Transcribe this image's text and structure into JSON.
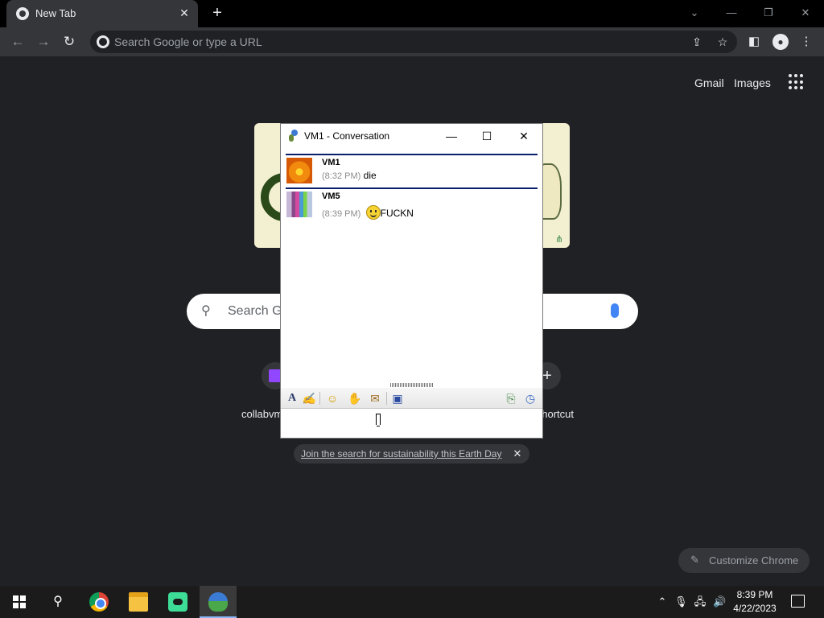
{
  "browser": {
    "tab_title": "New Tab",
    "tab_close": "✕",
    "new_tab": "+",
    "omnibox_placeholder": "Search Google or type a URL"
  },
  "ntp": {
    "gmail": "Gmail",
    "images": "Images",
    "search_placeholder": "Search Google or type a URL",
    "shortcut_1_label": "collabvm",
    "shortcut_add_label": "Add shortcut",
    "promo_text": "Join the search for sustainability this Earth Day",
    "customize_label": "Customize Chrome"
  },
  "messenger": {
    "title": "VM1 - Conversation",
    "messages": [
      {
        "sender": "VM1",
        "time": "(8:32 PM)",
        "text": "die",
        "avatar": "orange-flower",
        "emoticon": false
      },
      {
        "sender": "VM5",
        "time": "(8:39 PM)",
        "text": "FUCKN",
        "avatar": "group-photo",
        "emoticon": true
      }
    ],
    "input_value": ""
  },
  "taskbar": {
    "time": "8:39 PM",
    "date": "4/22/2023",
    "apps": [
      "chrome",
      "file-explorer",
      "chat-app",
      "windows-live-messenger"
    ]
  },
  "colors": {
    "chrome_bg": "#202124",
    "chrome_toolbar": "#35363a",
    "messenger_separator": "#0a1e6e",
    "taskbar": "#1b1b1b"
  }
}
